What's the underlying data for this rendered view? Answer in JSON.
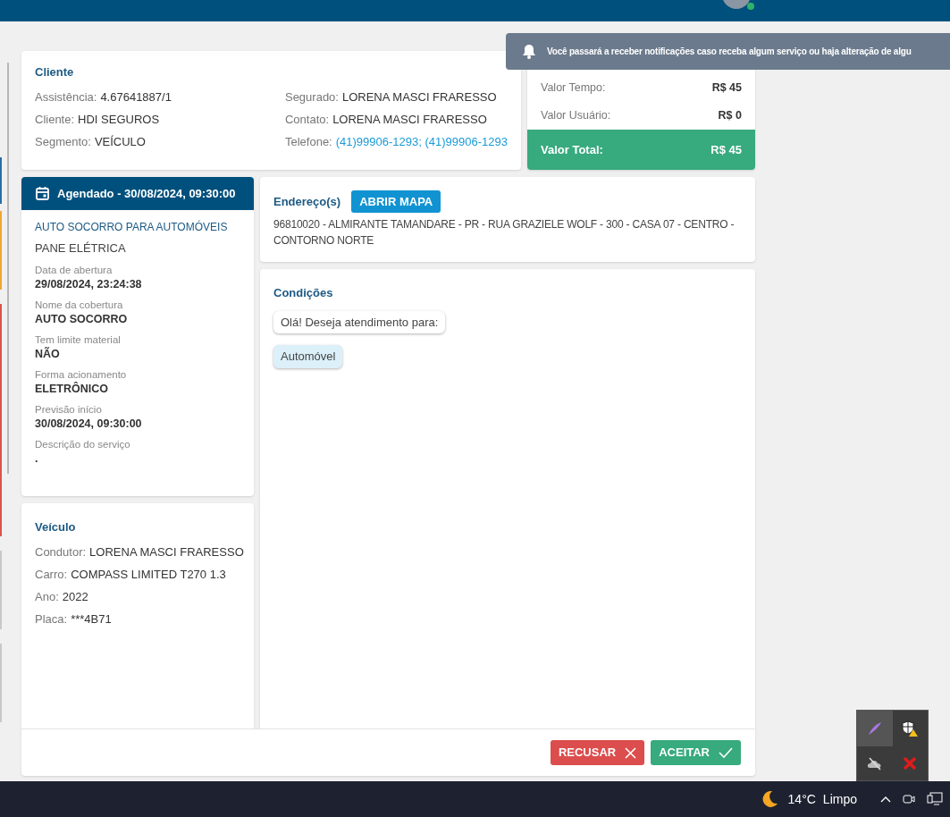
{
  "toast": {
    "text": "Você passará a receber notificações caso receba algum serviço ou haja alteração de algu"
  },
  "client": {
    "title": "Cliente",
    "columns": [
      [
        {
          "label": "Assistência:",
          "value": "4.67641887/1",
          "kind": "text"
        },
        {
          "label": "Cliente:",
          "value": "HDI SEGUROS",
          "kind": "text"
        },
        {
          "label": "Segmento:",
          "value": "VEÍCULO",
          "kind": "text"
        }
      ],
      [
        {
          "label": "Segurado:",
          "value": "LORENA MASCI FRARESSO",
          "kind": "text"
        },
        {
          "label": "Contato:",
          "value": "LORENA MASCI FRARESSO",
          "kind": "text"
        },
        {
          "label": "Telefone:",
          "value": "(41)99906-1293; (41)99906-1293",
          "kind": "link"
        }
      ]
    ]
  },
  "values": {
    "rows": [
      {
        "label": "Valor Tempo:",
        "value": "R$ 45"
      },
      {
        "label": "Valor Usuário:",
        "value": "R$ 0"
      }
    ],
    "total": {
      "label": "Valor Total:",
      "value": "R$ 45"
    }
  },
  "schedule": {
    "header": "Agendado - 30/08/2024, 09:30:00",
    "service": "AUTO SOCORRO PARA AUTOMÓVEIS",
    "problem": "PANE ELÉTRICA",
    "details": [
      {
        "label": "Data de abertura",
        "value": "29/08/2024, 23:24:38"
      },
      {
        "label": "Nome da cobertura",
        "value": "AUTO SOCORRO"
      },
      {
        "label": "Tem limite material",
        "value": "NÃO"
      },
      {
        "label": "Forma acionamento",
        "value": "ELETRÔNICO"
      },
      {
        "label": "Previsão início",
        "value": "30/08/2024, 09:30:00"
      },
      {
        "label": "Descrição do serviço",
        "value": "."
      }
    ]
  },
  "vehicle": {
    "title": "Veículo",
    "fields": [
      {
        "label": "Condutor:",
        "value": "LORENA MASCI FRARESSO"
      },
      {
        "label": "Carro:",
        "value": "COMPASS LIMITED T270 1.3"
      },
      {
        "label": "Ano:",
        "value": "2022"
      },
      {
        "label": "Placa:",
        "value": "***4B71"
      }
    ]
  },
  "address": {
    "title": "Endereço(s)",
    "button": "ABRIR MAPA",
    "text": "96810020 - ALMIRANTE TAMANDARE - PR - RUA GRAZIELE WOLF - 300 - CASA 07 - CENTRO - CONTORNO NORTE"
  },
  "conditions": {
    "title": "Condições",
    "question": "Olá! Deseja atendimento para:",
    "options": [
      {
        "label": "Automóvel",
        "selected": true
      }
    ]
  },
  "actions": [
    {
      "label": "RECUSAR",
      "kind": "reject"
    },
    {
      "label": "ACEITAR",
      "kind": "accept"
    }
  ],
  "taskbar": {
    "temperature": "14°C",
    "weather": "Limpo"
  }
}
